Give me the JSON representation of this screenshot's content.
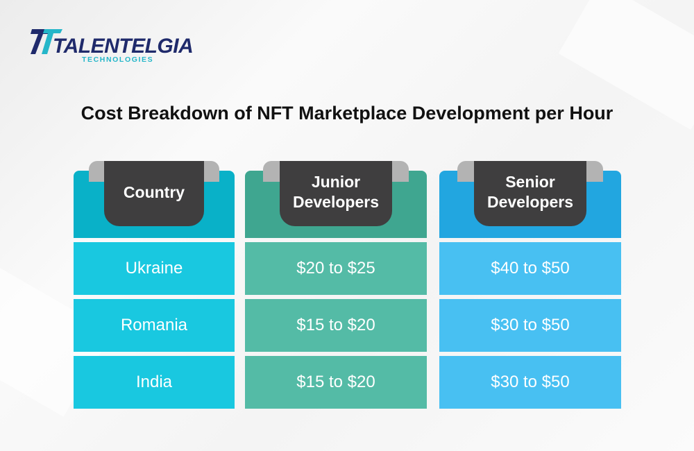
{
  "logo": {
    "name": "TALENTELGIA",
    "tagline": "TECHNOLOGIES",
    "colors": {
      "primary": "#1f2a6b",
      "accent": "#25b6c9"
    }
  },
  "title": "Cost Breakdown of NFT Marketplace Development per Hour",
  "chart_data": {
    "type": "table",
    "title": "Cost Breakdown of NFT Marketplace Development per Hour",
    "columns": [
      {
        "key": "country",
        "label_lines": [
          "Country"
        ],
        "header_color": "#09b1c8",
        "cell_color": "#19c8e0"
      },
      {
        "key": "junior",
        "label_lines": [
          "Junior",
          "Developers"
        ],
        "header_color": "#3fa690",
        "cell_color": "#54bba6"
      },
      {
        "key": "senior",
        "label_lines": [
          "Senior",
          "Developers"
        ],
        "header_color": "#22a6e0",
        "cell_color": "#48c0f2"
      }
    ],
    "rows": [
      {
        "country": "Ukraine",
        "junior": "$20 to $25",
        "senior": "$40 to $50"
      },
      {
        "country": "Romania",
        "junior": "$15 to $20",
        "senior": "$30 to $50"
      },
      {
        "country": "India",
        "junior": "$15 to $20",
        "senior": "$30 to $50"
      }
    ],
    "numeric_ranges_usd_per_hour": {
      "Ukraine": {
        "junior": [
          20,
          25
        ],
        "senior": [
          40,
          50
        ]
      },
      "Romania": {
        "junior": [
          15,
          20
        ],
        "senior": [
          30,
          50
        ]
      },
      "India": {
        "junior": [
          15,
          20
        ],
        "senior": [
          30,
          50
        ]
      }
    }
  }
}
